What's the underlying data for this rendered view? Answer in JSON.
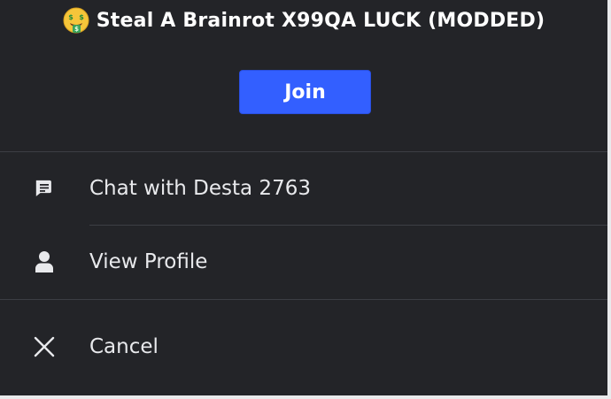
{
  "header": {
    "emoji": "money-mouth-face-icon",
    "title": "Steal A Brainrot X99QA LUCK (MODDED)"
  },
  "join_button": {
    "label": "Join",
    "color": "#335fff"
  },
  "menu": {
    "items": [
      {
        "label": "Chat with Desta 2763",
        "icon": "chat-icon"
      },
      {
        "label": "View Profile",
        "icon": "person-icon"
      },
      {
        "label": "Cancel",
        "icon": "close-icon"
      }
    ]
  },
  "colors": {
    "background": "#232428",
    "divider": "#3c3e44",
    "text": "#e8e9ec"
  }
}
